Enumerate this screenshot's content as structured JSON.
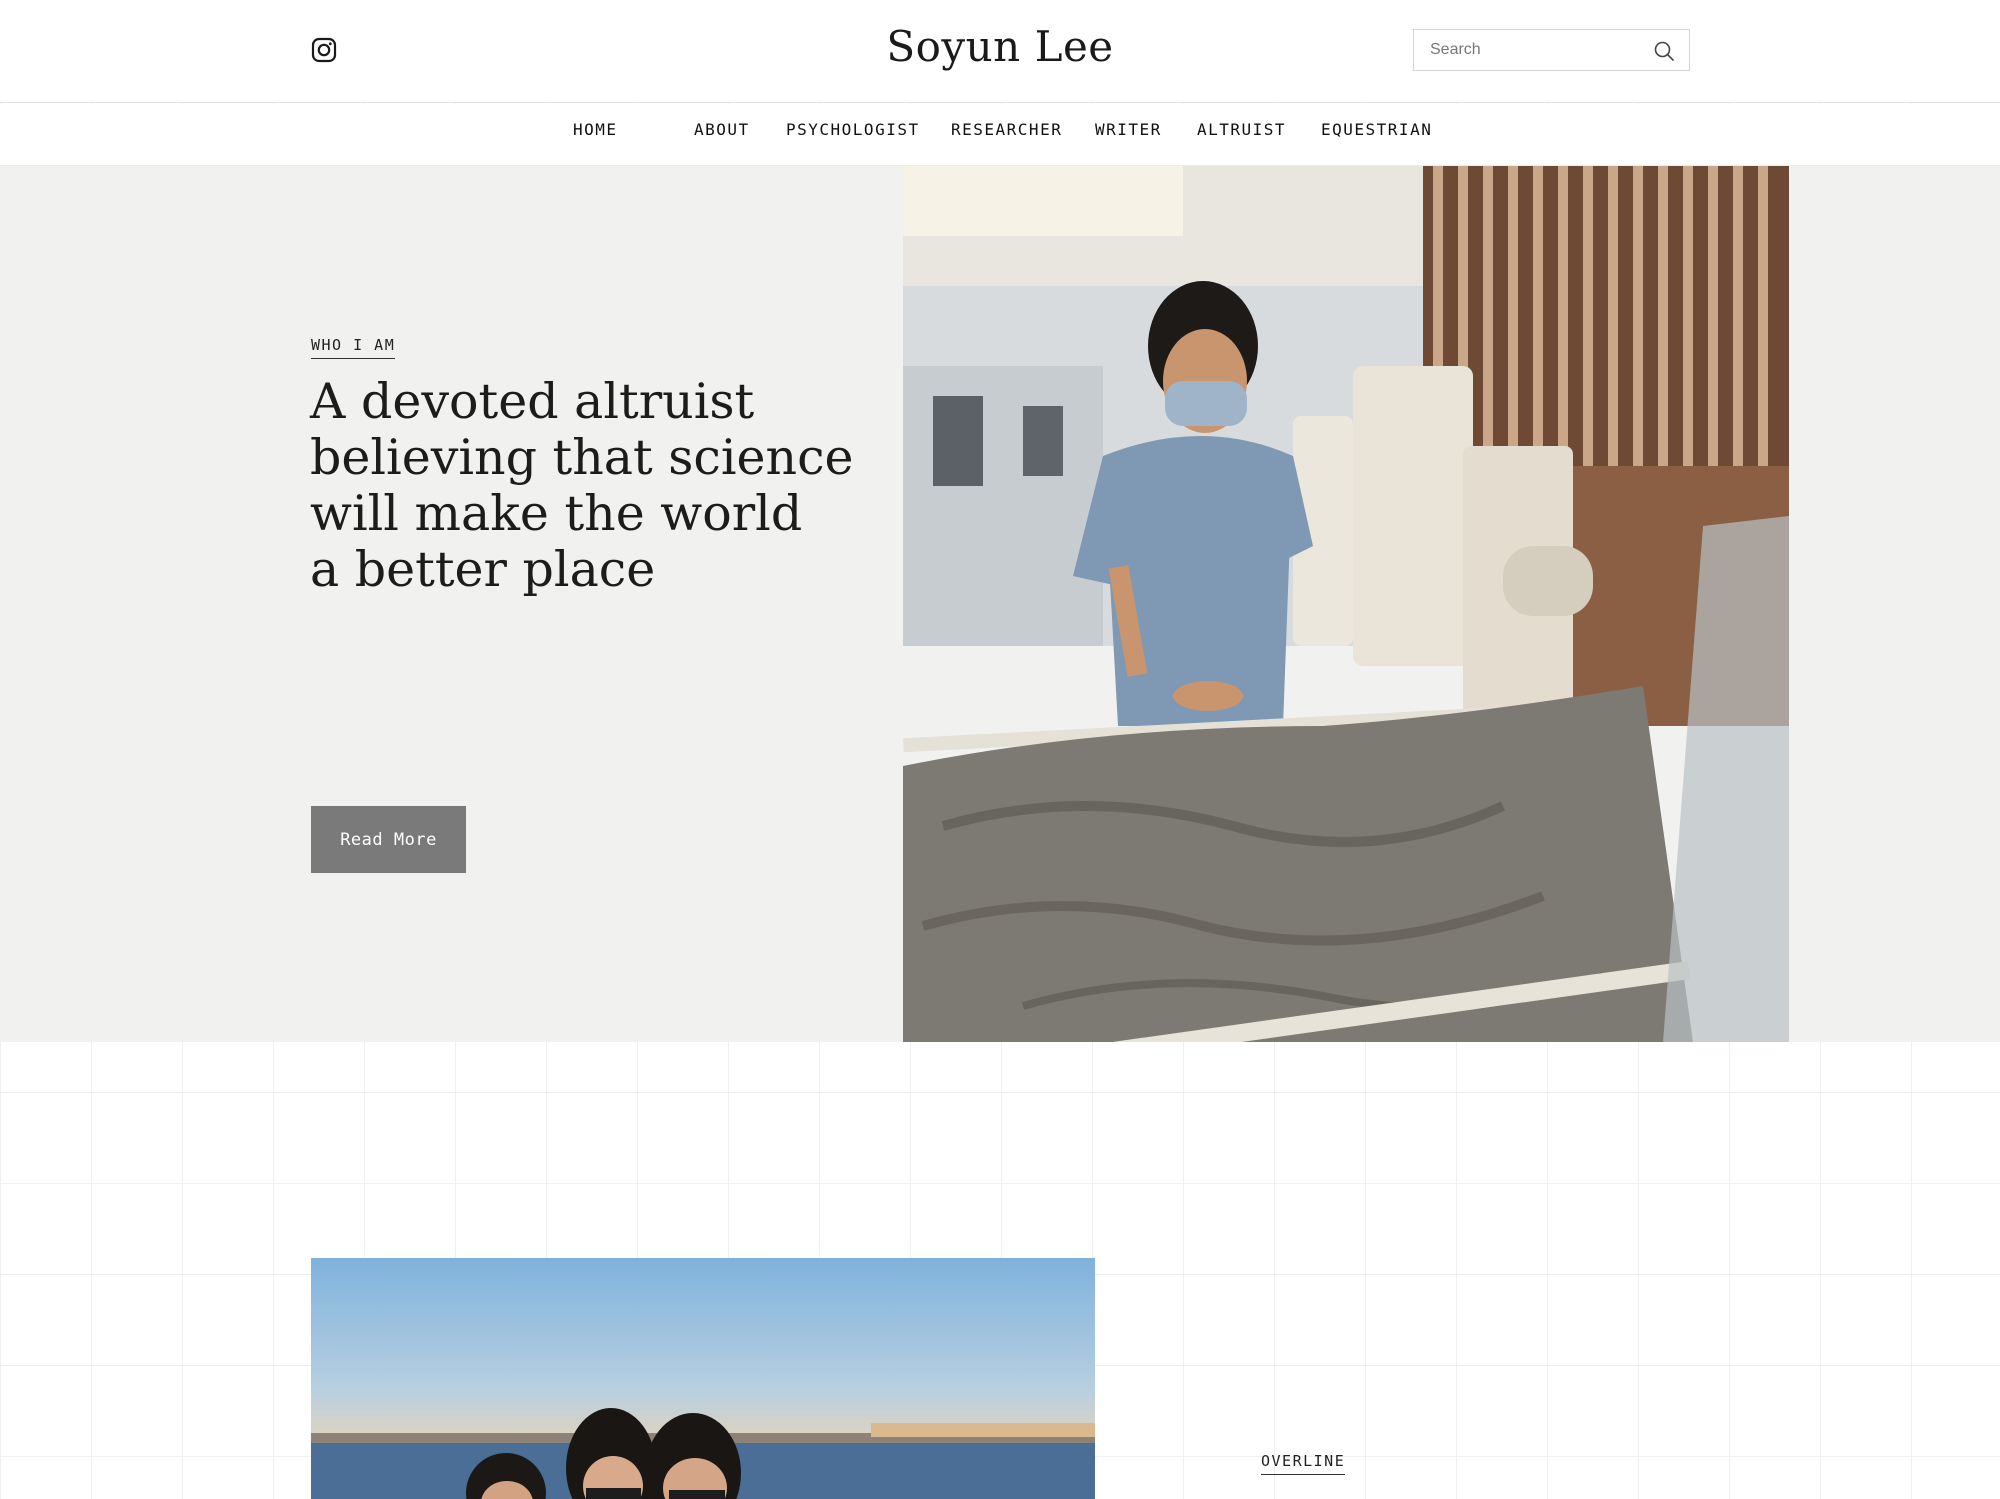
{
  "header": {
    "site_title": "Soyun Lee",
    "social_icon": "instagram-icon",
    "search_placeholder": "Search",
    "search_icon": "search-icon"
  },
  "nav": {
    "items": [
      {
        "label": "HOME"
      },
      {
        "label": "ABOUT"
      },
      {
        "label": "PSYCHOLOGIST"
      },
      {
        "label": "RESEARCHER"
      },
      {
        "label": "WRITER"
      },
      {
        "label": "ALTRUIST"
      },
      {
        "label": "EQUESTRIAN"
      }
    ]
  },
  "hero": {
    "overline": "WHO I AM",
    "title_lines": [
      "A devoted altruist",
      "believing that science",
      "will make the world",
      "a better place"
    ],
    "button_label": "Read More",
    "background_color": "#f1f1f0",
    "button_color": "#7a7a7a"
  },
  "second_section": {
    "overline": "OVERLINE"
  }
}
